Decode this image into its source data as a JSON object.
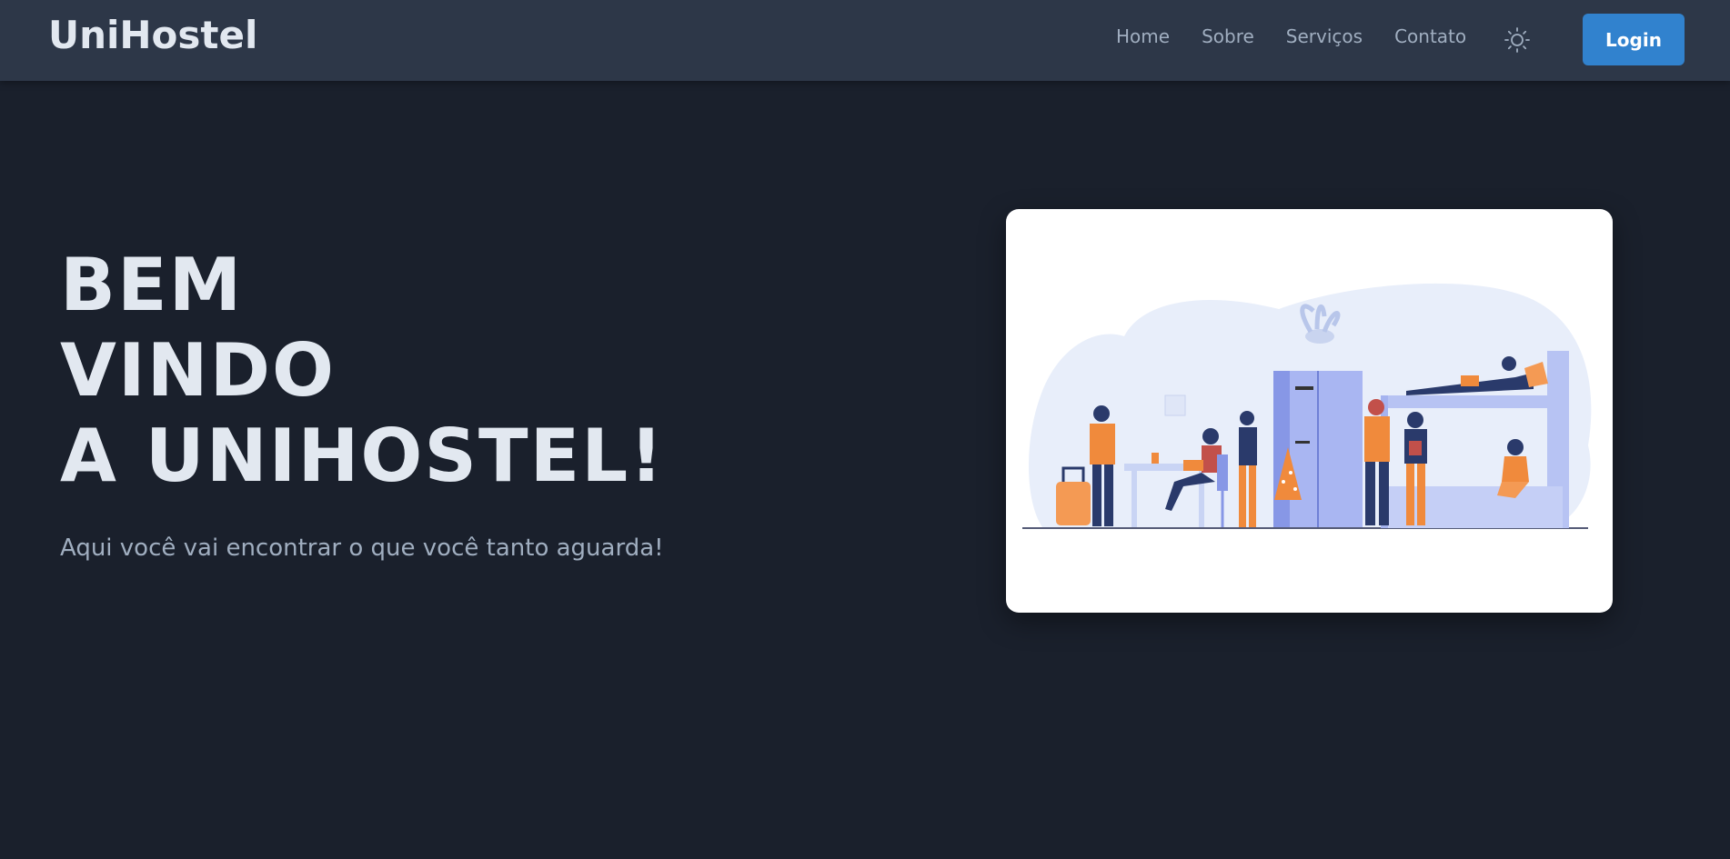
{
  "brand": {
    "name": "UniHostel"
  },
  "nav": {
    "links": [
      "Home",
      "Sobre",
      "Serviços",
      "Contato"
    ],
    "theme_icon": "sun-icon",
    "login_label": "Login"
  },
  "hero": {
    "title_lines": [
      "BEM",
      "VINDO",
      "A UNIHOSTEL!"
    ],
    "subtitle": "Aqui você vai encontrar o que você tanto aguarda!",
    "illustration": "hostel-people-illustration"
  },
  "colors": {
    "background": "#1a202c",
    "navbar": "#2d3748",
    "accent": "#3182ce",
    "text_primary": "#e2e8f0",
    "text_secondary": "#a0aec0"
  }
}
